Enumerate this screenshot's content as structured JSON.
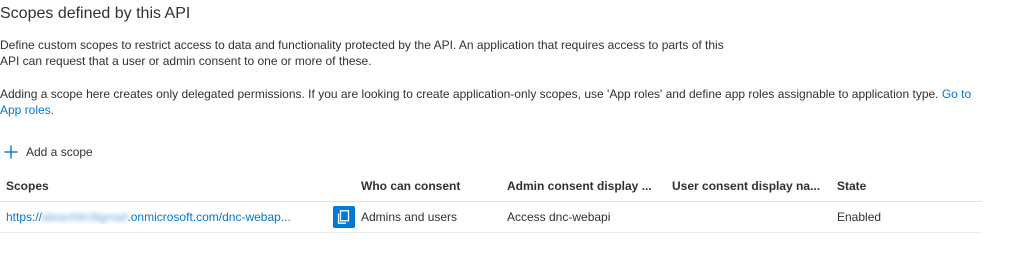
{
  "section": {
    "title": "Scopes defined by this API",
    "description_line1": "Define custom scopes to restrict access to data and functionality protected by the API. An application that requires access to parts of this",
    "description_line2": "API can request that a user or admin consent to one or more of these.",
    "delegated_note": "Adding a scope here creates only delegated permissions. If you are looking to create application-only scopes, use 'App roles' and define app roles assignable to application type. ",
    "app_roles_link": "Go to App roles."
  },
  "toolbar": {
    "add_scope_label": "Add a scope",
    "add_scope_icon": "plus-icon"
  },
  "table": {
    "columns": [
      "Scopes",
      "Who can consent",
      "Admin consent display ...",
      "User consent display na...",
      "State"
    ],
    "rows": [
      {
        "scope_prefix": "https://",
        "scope_redacted": "aleachlin3lgmail",
        "scope_suffix": ".onmicrosoft.com/dnc-webap...",
        "copy_icon": "copy-icon",
        "who_can_consent": "Admins and users",
        "admin_consent_display": "Access dnc-webapi",
        "user_consent_display": "",
        "state": "Enabled"
      }
    ]
  },
  "colors": {
    "accent": "#0078d4",
    "text": "#323130"
  }
}
